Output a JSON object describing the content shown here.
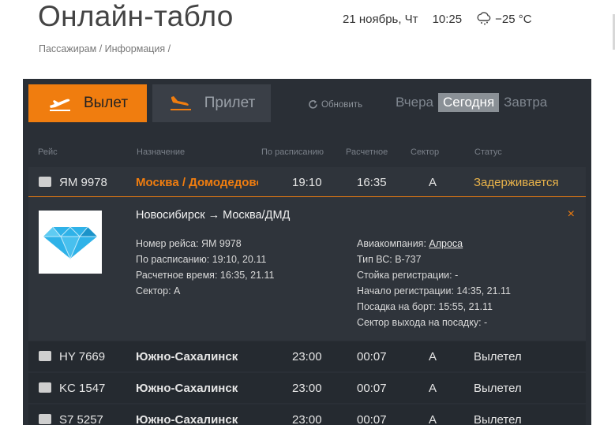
{
  "header": {
    "title": "Онлайн-табло",
    "date": "21 ноябрь, Чт",
    "time": "10:25",
    "weather_icon": "snow-cloud-icon",
    "temperature": "−25 °C"
  },
  "breadcrumb": {
    "item1": "Пассажирам",
    "sep1": " / ",
    "item2": "Информация",
    "sep2": " /"
  },
  "tabs": {
    "departure": "Вылет",
    "arrival": "Прилет"
  },
  "refresh_label": "Обновить",
  "days": {
    "yesterday": "Вчера",
    "today": "Сегодня",
    "tomorrow": "Завтра"
  },
  "columns": {
    "flight": "Рейс",
    "destination": "Назначение",
    "scheduled": "По расписанию",
    "estimated": "Расчетное",
    "sector": "Сектор",
    "status": "Статус"
  },
  "flights": [
    {
      "flight": "ЯМ 9978",
      "destination": "Москва / Домодедово",
      "scheduled": "19:10",
      "estimated": "16:35",
      "sector": "A",
      "status": "Задерживается"
    },
    {
      "flight": "HY 7669",
      "destination": "Южно-Сахалинск",
      "scheduled": "23:00",
      "estimated": "00:07",
      "sector": "A",
      "status": "Вылетел"
    },
    {
      "flight": "KC 1547",
      "destination": "Южно-Сахалинск",
      "scheduled": "23:00",
      "estimated": "00:07",
      "sector": "A",
      "status": "Вылетел"
    },
    {
      "flight": "S7 5257",
      "destination": "Южно-Сахалинск",
      "scheduled": "23:00",
      "estimated": "00:07",
      "sector": "A",
      "status": "Вылетел"
    }
  ],
  "details": {
    "route": "Новосибирск → Москва/ДМД",
    "close_icon": "×",
    "flight_number": "Номер рейса: ЯМ 9978",
    "scheduled": "По расписанию: 19:10, 20.11",
    "estimated": "Расчетное время: 16:35, 21.11",
    "sector": "Сектор: A",
    "airline_label": "Авиакомпания: ",
    "airline_name": "Алроса",
    "aircraft": "Тип ВС: B-737",
    "checkin_desk": "Стойка регистрации: -",
    "checkin_start": "Начало регистрации: 14:35, 21.11",
    "boarding": "Посадка на борт: 15:55, 21.11",
    "gate_sector": "Сектор выхода на посадку: -"
  }
}
